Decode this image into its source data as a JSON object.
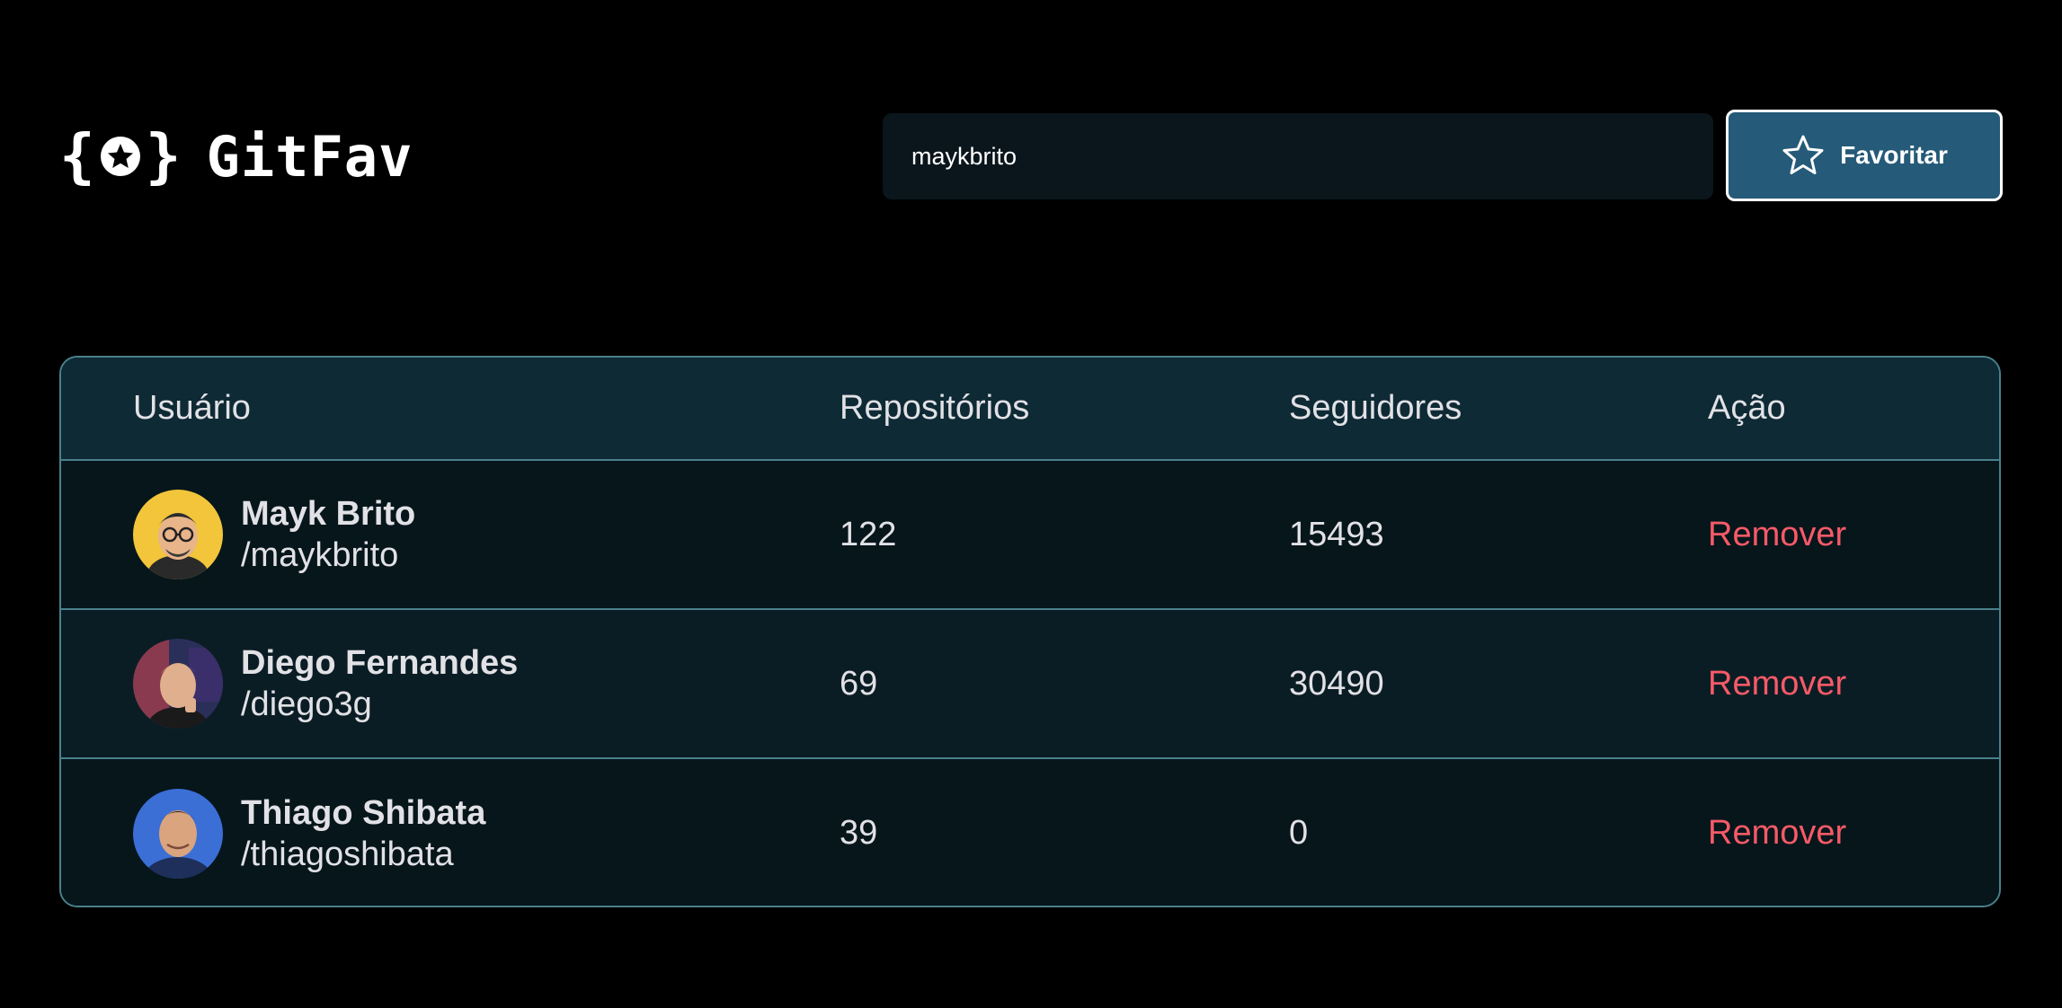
{
  "app": {
    "name": "GitFav"
  },
  "search": {
    "value": "maykbrito"
  },
  "toolbar": {
    "favorite_label": "Favoritar"
  },
  "table": {
    "headers": [
      "Usuário",
      "Repositórios",
      "Seguidores",
      "Ação"
    ],
    "rows": [
      {
        "name": "Mayk Brito",
        "login": "/maykbrito",
        "repositories": "122",
        "followers": "15493",
        "action": "Remover"
      },
      {
        "name": "Diego Fernandes",
        "login": "/diego3g",
        "repositories": "69",
        "followers": "30490",
        "action": "Remover"
      },
      {
        "name": "Thiago Shibata",
        "login": "/thiagoshibata",
        "repositories": "39",
        "followers": "0",
        "action": "Remover"
      }
    ]
  },
  "colors": {
    "background": "#000000",
    "accent": "#255a78",
    "remove": "#f75a68",
    "table_border": "#4a808c"
  },
  "icons": {
    "logo": "star-braces-icon",
    "favorite": "star-outline-icon"
  }
}
